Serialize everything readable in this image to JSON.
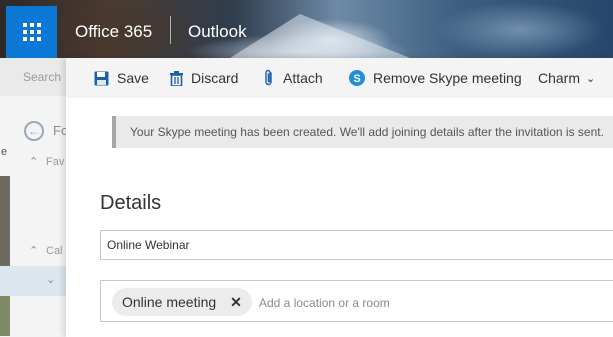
{
  "suite": {
    "brand": "Office 365",
    "app": "Outlook"
  },
  "folder_pane": {
    "search": "Search",
    "back_label": "Fo",
    "favorites_label": "Fav",
    "calendar_label": "Cal",
    "edge_char": "e"
  },
  "toolbar": {
    "save": "Save",
    "discard": "Discard",
    "attach": "Attach",
    "remove_skype": "Remove Skype meeting",
    "charm": "Charm"
  },
  "info": {
    "message": "Your Skype meeting has been created. We'll add joining details after the invitation is sent."
  },
  "details": {
    "title": "Details",
    "event_title_value": "Online Webinar",
    "location_chip": "Online meeting",
    "location_placeholder": "Add a location or a room"
  },
  "colors": {
    "accent": "#0a78d4",
    "skype": "#00aff0"
  }
}
